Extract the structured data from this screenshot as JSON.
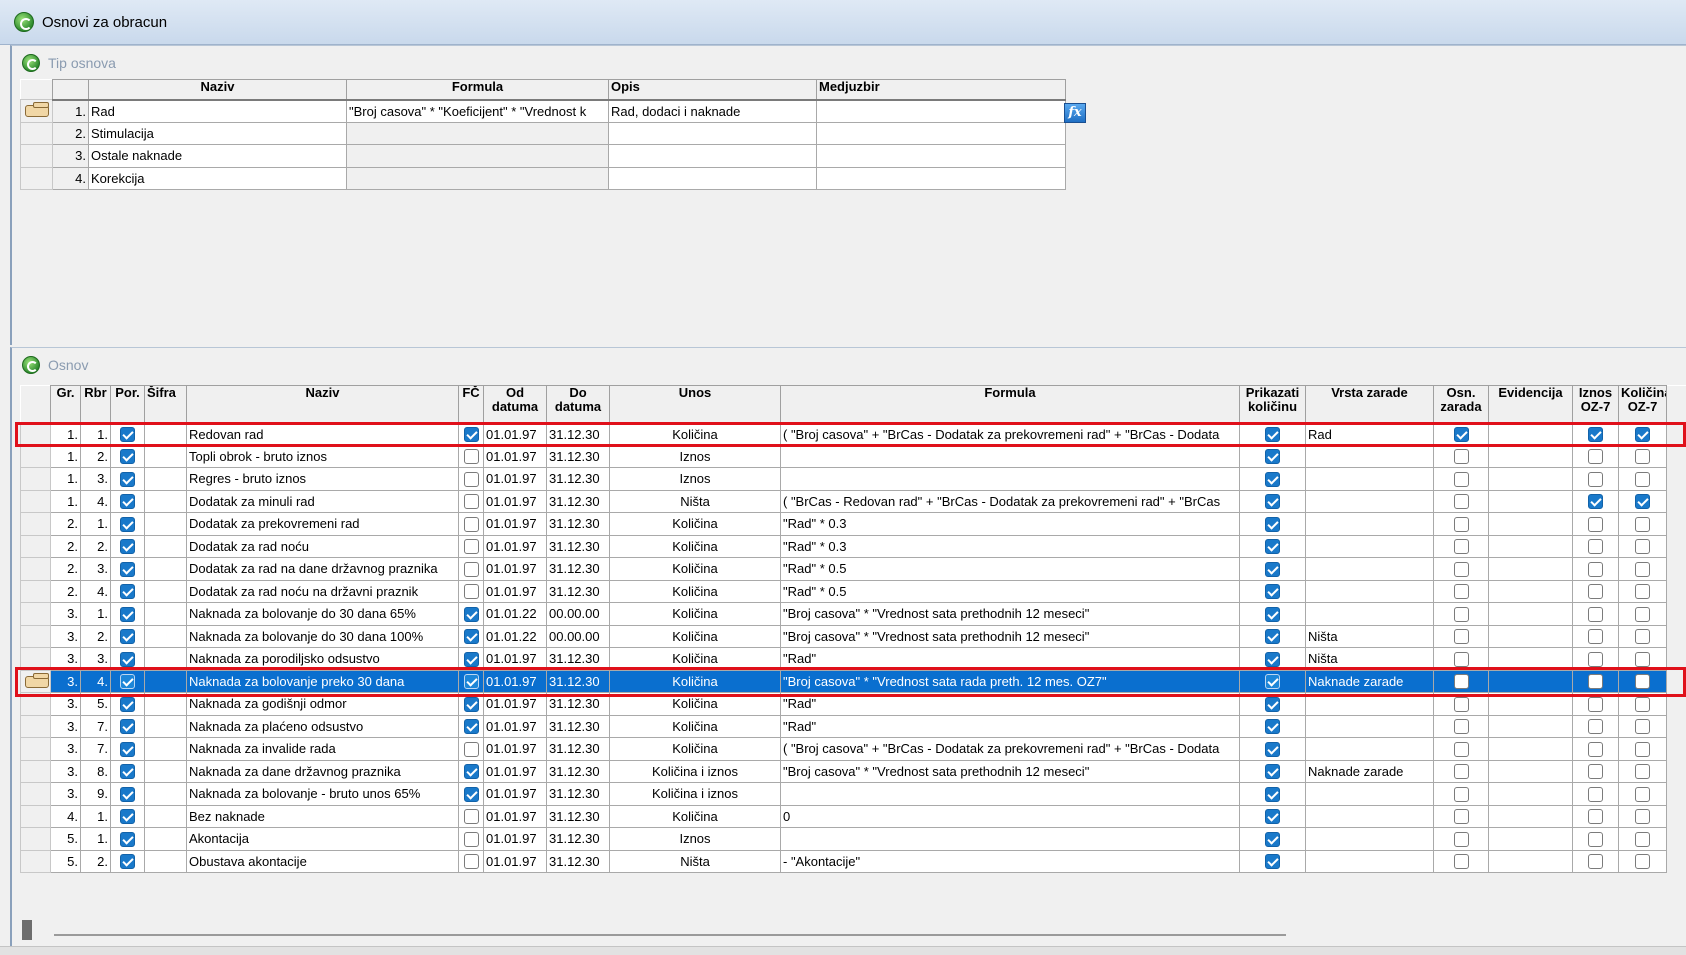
{
  "window": {
    "title": "Osnovi za obracun"
  },
  "tip_osnova": {
    "caption": "Tip osnova",
    "headers": [
      "Naziv",
      "Formula",
      "Opis",
      "Medjuzbir"
    ],
    "rows": [
      {
        "num": "1.",
        "naziv": "Rad",
        "formula": "\"Broj casova\" *  \"Koeficijent\" *  \"Vrednost k",
        "opis": "Rad, dodaci i naknade",
        "medjuzbir": ""
      },
      {
        "num": "2.",
        "naziv": "Stimulacija",
        "formula": "",
        "opis": "",
        "medjuzbir": ""
      },
      {
        "num": "3.",
        "naziv": "Ostale naknade",
        "formula": "",
        "opis": "",
        "medjuzbir": ""
      },
      {
        "num": "4.",
        "naziv": "Korekcija",
        "formula": "",
        "opis": "",
        "medjuzbir": ""
      }
    ],
    "fx_label": "fx"
  },
  "osnov": {
    "caption": "Osnov",
    "headers": {
      "gr": "Gr.",
      "rbr": "Rbr",
      "por": "Por.",
      "sifra": "Šifra",
      "naziv": "Naziv",
      "fc": "FČ",
      "od": "Od datuma",
      "do": "Do datuma",
      "unos": "Unos",
      "formula": "Formula",
      "prikazati": "Prikazati količinu",
      "vrsta": "Vrsta zarade",
      "osn": "Osn. zarada",
      "evidencija": "Evidencija",
      "iznos": "Iznos OZ-7",
      "kolicina": "Količina OZ-7"
    },
    "rows": [
      {
        "gr": "1.",
        "rbr": "1.",
        "por": true,
        "sifra": "",
        "naziv": "Redovan rad",
        "fc": true,
        "od": "01.01.97",
        "do": "31.12.30",
        "unos": "Količina",
        "formula": "(  \"Broj casova\" + \"BrCas - Dodatak za prekovremeni rad\" + \"BrCas - Dodata",
        "prik": true,
        "vrsta": "Rad",
        "osn": true,
        "evid": "",
        "iznos": true,
        "kol": true
      },
      {
        "gr": "1.",
        "rbr": "2.",
        "por": true,
        "sifra": "",
        "naziv": "Topli obrok - bruto iznos",
        "fc": false,
        "od": "01.01.97",
        "do": "31.12.30",
        "unos": "Iznos",
        "formula": "",
        "prik": true,
        "vrsta": "",
        "osn": false,
        "evid": "",
        "iznos": false,
        "kol": false
      },
      {
        "gr": "1.",
        "rbr": "3.",
        "por": true,
        "sifra": "",
        "naziv": "Regres - bruto iznos",
        "fc": false,
        "od": "01.01.97",
        "do": "31.12.30",
        "unos": "Iznos",
        "formula": "",
        "prik": true,
        "vrsta": "",
        "osn": false,
        "evid": "",
        "iznos": false,
        "kol": false
      },
      {
        "gr": "1.",
        "rbr": "4.",
        "por": true,
        "sifra": "",
        "naziv": "Dodatak za minuli rad",
        "fc": false,
        "od": "01.01.97",
        "do": "31.12.30",
        "unos": "Ništa",
        "formula": "(  \"BrCas - Redovan rad\" + \"BrCas - Dodatak za prekovremeni rad\" + \"BrCas",
        "prik": true,
        "vrsta": "",
        "osn": false,
        "evid": "",
        "iznos": true,
        "kol": true
      },
      {
        "gr": "2.",
        "rbr": "1.",
        "por": true,
        "sifra": "",
        "naziv": "Dodatak za prekovremeni rad",
        "fc": false,
        "od": "01.01.97",
        "do": "31.12.30",
        "unos": "Količina",
        "formula": "\"Rad\" * 0.3",
        "prik": true,
        "vrsta": "",
        "osn": false,
        "evid": "",
        "iznos": false,
        "kol": false
      },
      {
        "gr": "2.",
        "rbr": "2.",
        "por": true,
        "sifra": "",
        "naziv": "Dodatak za rad noću",
        "fc": false,
        "od": "01.01.97",
        "do": "31.12.30",
        "unos": "Količina",
        "formula": "\"Rad\" * 0.3",
        "prik": true,
        "vrsta": "",
        "osn": false,
        "evid": "",
        "iznos": false,
        "kol": false
      },
      {
        "gr": "2.",
        "rbr": "3.",
        "por": true,
        "sifra": "",
        "naziv": "Dodatak za rad na dane državnog praznika",
        "fc": false,
        "od": "01.01.97",
        "do": "31.12.30",
        "unos": "Količina",
        "formula": "\"Rad\" * 0.5",
        "prik": true,
        "vrsta": "",
        "osn": false,
        "evid": "",
        "iznos": false,
        "kol": false
      },
      {
        "gr": "2.",
        "rbr": "4.",
        "por": true,
        "sifra": "",
        "naziv": "Dodatak za rad noću na državni praznik",
        "fc": false,
        "od": "01.01.97",
        "do": "31.12.30",
        "unos": "Količina",
        "formula": "\"Rad\" * 0.5",
        "prik": true,
        "vrsta": "",
        "osn": false,
        "evid": "",
        "iznos": false,
        "kol": false
      },
      {
        "gr": "3.",
        "rbr": "1.",
        "por": true,
        "sifra": "",
        "naziv": "Naknada za bolovanje do 30 dana 65%",
        "fc": true,
        "od": "01.01.22",
        "do": "00.00.00",
        "unos": "Količina",
        "formula": "\"Broj casova\" *   \"Vrednost sata prethodnih 12 meseci\"",
        "prik": true,
        "vrsta": "",
        "osn": false,
        "evid": "",
        "iznos": false,
        "kol": false
      },
      {
        "gr": "3.",
        "rbr": "2.",
        "por": true,
        "sifra": "",
        "naziv": "Naknada za bolovanje do 30 dana 100%",
        "fc": true,
        "od": "01.01.22",
        "do": "00.00.00",
        "unos": "Količina",
        "formula": "\"Broj casova\" *  \"Vrednost sata prethodnih 12 meseci\"",
        "prik": true,
        "vrsta": "Ništa",
        "osn": false,
        "evid": "",
        "iznos": false,
        "kol": false
      },
      {
        "gr": "3.",
        "rbr": "3.",
        "por": true,
        "sifra": "",
        "naziv": "Naknada za porodiljsko odsustvo",
        "fc": true,
        "od": "01.01.97",
        "do": "31.12.30",
        "unos": "Količina",
        "formula": "\"Rad\"",
        "prik": true,
        "vrsta": "Ništa",
        "osn": false,
        "evid": "",
        "iznos": false,
        "kol": false
      },
      {
        "gr": "3.",
        "rbr": "4.",
        "por": true,
        "sifra": "",
        "naziv": "Naknada za bolovanje preko 30 dana",
        "fc": true,
        "od": "01.01.97",
        "do": "31.12.30",
        "unos": "Količina",
        "formula": "\"Broj casova\"  *   \"Vrednost sata rada preth. 12 mes. OZ7\"",
        "prik": true,
        "vrsta": "Naknade zarade",
        "osn": false,
        "evid": "",
        "iznos": false,
        "kol": false,
        "selected": true
      },
      {
        "gr": "3.",
        "rbr": "5.",
        "por": true,
        "sifra": "",
        "naziv": "Naknada za godišnji odmor",
        "fc": true,
        "od": "01.01.97",
        "do": "31.12.30",
        "unos": "Količina",
        "formula": "\"Rad\"",
        "prik": true,
        "vrsta": "",
        "osn": false,
        "evid": "",
        "iznos": false,
        "kol": false
      },
      {
        "gr": "3.",
        "rbr": "7.",
        "por": true,
        "sifra": "",
        "naziv": "Naknada za plaćeno odsustvo",
        "fc": true,
        "od": "01.01.97",
        "do": "31.12.30",
        "unos": "Količina",
        "formula": "\"Rad\"",
        "prik": true,
        "vrsta": "",
        "osn": false,
        "evid": "",
        "iznos": false,
        "kol": false
      },
      {
        "gr": "3.",
        "rbr": "7.",
        "por": true,
        "sifra": "",
        "naziv": "Naknada za invalide rada",
        "fc": false,
        "od": "01.01.97",
        "do": "31.12.30",
        "unos": "Količina",
        "formula": "(  \"Broj casova\" + \"BrCas - Dodatak za prekovremeni rad\" + \"BrCas - Dodata",
        "prik": true,
        "vrsta": "",
        "osn": false,
        "evid": "",
        "iznos": false,
        "kol": false
      },
      {
        "gr": "3.",
        "rbr": "8.",
        "por": true,
        "sifra": "",
        "naziv": "Naknada za dane državnog praznika",
        "fc": true,
        "od": "01.01.97",
        "do": "31.12.30",
        "unos": "Količina i iznos",
        "formula": "\"Broj casova\" * \"Vrednost sata prethodnih 12 meseci\"",
        "prik": true,
        "vrsta": "Naknade zarade",
        "osn": false,
        "evid": "",
        "iznos": false,
        "kol": false
      },
      {
        "gr": "3.",
        "rbr": "9.",
        "por": true,
        "sifra": "",
        "naziv": "Naknada za bolovanje  - bruto unos 65%",
        "fc": true,
        "od": "01.01.97",
        "do": "31.12.30",
        "unos": "Količina i iznos",
        "formula": "",
        "prik": true,
        "vrsta": "",
        "osn": false,
        "evid": "",
        "iznos": false,
        "kol": false
      },
      {
        "gr": "4.",
        "rbr": "1.",
        "por": true,
        "sifra": "",
        "naziv": "Bez naknade",
        "fc": false,
        "od": "01.01.97",
        "do": "31.12.30",
        "unos": "Količina",
        "formula": "0",
        "prik": true,
        "vrsta": "",
        "osn": false,
        "evid": "",
        "iznos": false,
        "kol": false
      },
      {
        "gr": "5.",
        "rbr": "1.",
        "por": true,
        "sifra": "",
        "naziv": "Akontacija",
        "fc": false,
        "od": "01.01.97",
        "do": "31.12.30",
        "unos": "Iznos",
        "formula": "",
        "prik": true,
        "vrsta": "",
        "osn": false,
        "evid": "",
        "iznos": false,
        "kol": false
      },
      {
        "gr": "5.",
        "rbr": "2.",
        "por": true,
        "sifra": "",
        "naziv": "Obustava akontacije",
        "fc": false,
        "od": "01.01.97",
        "do": "31.12.30",
        "unos": "Ništa",
        "formula": "- \"Akontacije\"",
        "prik": true,
        "vrsta": "",
        "osn": false,
        "evid": "",
        "iznos": false,
        "kol": false
      }
    ]
  },
  "colors": {
    "selection": "#0a6fcf",
    "highlight_box": "#e0101a",
    "checkbox_on": "#1979ca"
  }
}
